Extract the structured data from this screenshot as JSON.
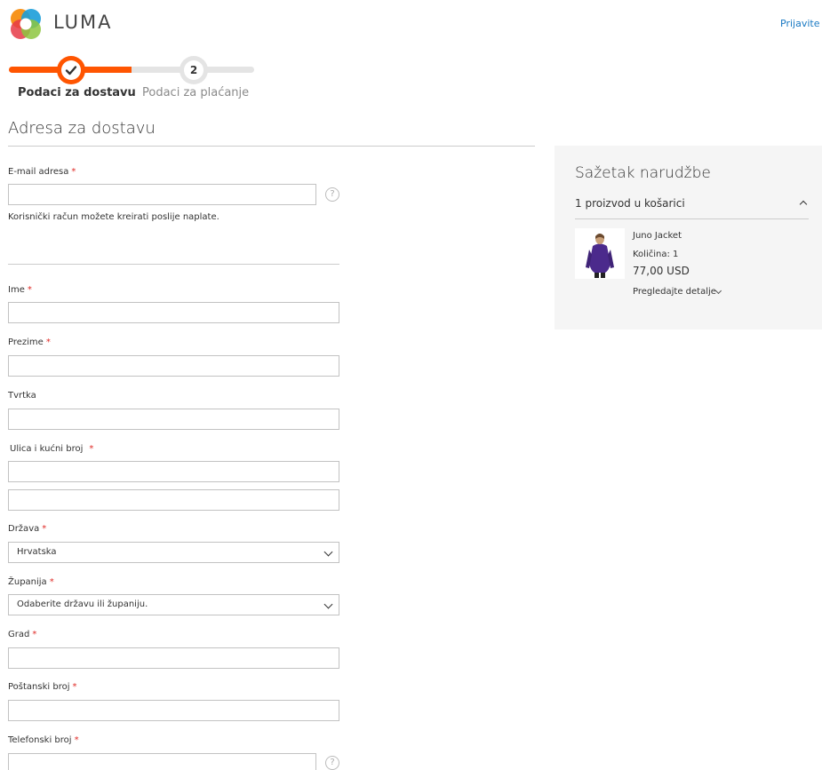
{
  "header": {
    "logo_text": "LUMA",
    "signin_link": "Prijavite s"
  },
  "progress": {
    "step1_label": "Podaci za dostavu",
    "step2_number": "2",
    "step2_label": "Podaci za plaćanje"
  },
  "shipping": {
    "title": "Adresa za dostavu",
    "email": {
      "label": "E-mail adresa",
      "required": "*",
      "value": "",
      "help": "?"
    },
    "email_note": "Korisnički račun možete kreirati poslije naplate.",
    "first_name": {
      "label": "Ime",
      "required": "*",
      "value": ""
    },
    "last_name": {
      "label": "Prezime",
      "required": "*",
      "value": ""
    },
    "company": {
      "label": "Tvrtka",
      "value": ""
    },
    "street": {
      "label": "Ulica i kućni broj",
      "required": "*",
      "line1": "",
      "line2": ""
    },
    "country": {
      "label": "Država",
      "required": "*",
      "value": "Hrvatska"
    },
    "region": {
      "label": "Županija",
      "required": "*",
      "value": "Odaberite državu ili županiju."
    },
    "city": {
      "label": "Grad",
      "required": "*",
      "value": ""
    },
    "postcode": {
      "label": "Poštanski broj",
      "required": "*",
      "value": ""
    },
    "phone": {
      "label": "Telefonski broj",
      "required": "*",
      "value": "",
      "help": "?"
    }
  },
  "summary": {
    "title": "Sažetak narudžbe",
    "items_count": "1 proizvod u košarici",
    "product": {
      "name": "Juno Jacket",
      "qty": "Količina: 1",
      "price": "77,00 USD",
      "details_link": "Pregledajte detalje"
    }
  },
  "colors": {
    "accent": "#ff5501",
    "link": "#1979c3",
    "required": "#e02b27",
    "summary_bg": "#f5f5f5"
  }
}
